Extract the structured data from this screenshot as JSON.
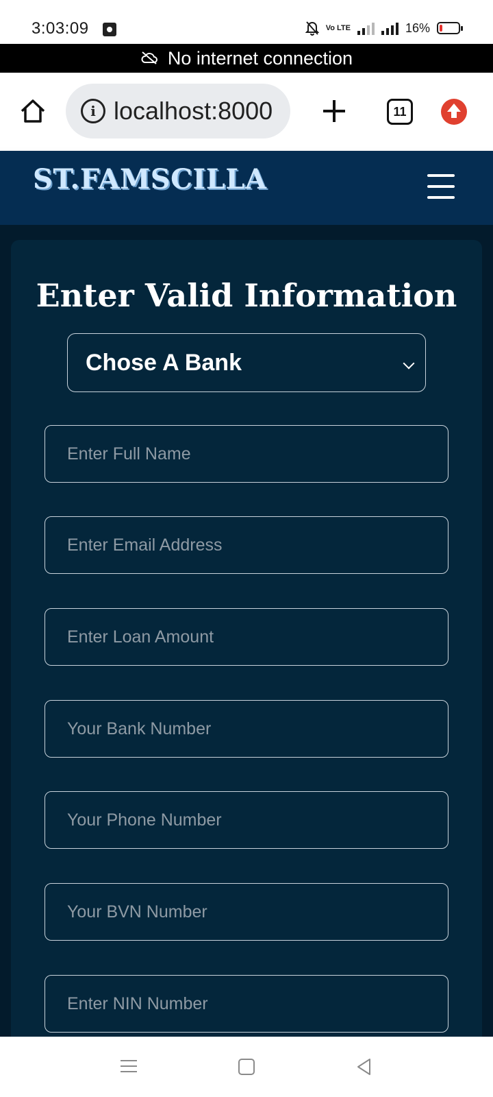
{
  "status_bar": {
    "time": "3:03:09",
    "battery_percent": "16%",
    "battery_level": 0.16,
    "network_label": "Vo LTE",
    "icons": [
      "app-notification-icon",
      "mute-bell-icon",
      "volte-icon",
      "signal-icon",
      "signal-icon",
      "battery-icon"
    ]
  },
  "offline_banner": {
    "text": "No internet connection",
    "icon": "cloud-off-icon"
  },
  "browser": {
    "url": "localhost:8000",
    "tab_count": "11",
    "icons": [
      "home-icon",
      "info-icon",
      "plus-icon",
      "tabs-icon",
      "update-icon"
    ]
  },
  "site": {
    "brand": "ST.FAMSCILLA",
    "menu_icon": "hamburger-menu-icon"
  },
  "form": {
    "title": "Enter Valid Information",
    "bank_select": {
      "selected": "Chose A Bank"
    },
    "fields": {
      "full_name": {
        "placeholder": "Enter Full Name"
      },
      "email": {
        "placeholder": "Enter Email Address"
      },
      "loan_amount": {
        "placeholder": "Enter Loan Amount"
      },
      "bank_number": {
        "placeholder": "Your Bank Number"
      },
      "phone_number": {
        "placeholder": "Your Phone Number"
      },
      "bvn_number": {
        "placeholder": "Your BVN Number"
      },
      "nin_number": {
        "placeholder": "Enter NIN Number"
      }
    }
  },
  "colors": {
    "header_bg": "#052d52",
    "page_bg": "#031b2c",
    "card_bg": "#04263b",
    "brand_text": "#cfe8ff",
    "offline_bg": "#000000",
    "update_badge": "#e0402f"
  }
}
